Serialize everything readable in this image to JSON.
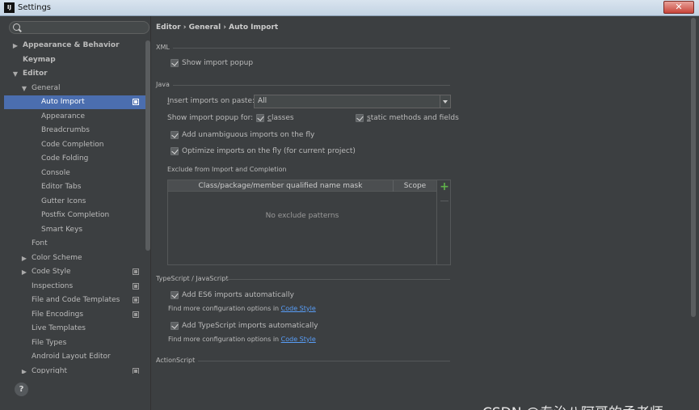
{
  "window": {
    "title": "Settings",
    "app_icon_text": "IJ"
  },
  "search": {
    "placeholder": ""
  },
  "tree": [
    {
      "label": "Appearance & Behavior",
      "level": 0,
      "arrow": "right",
      "bold": true
    },
    {
      "label": "Keymap",
      "level": 0,
      "arrow": "",
      "bold": true
    },
    {
      "label": "Editor",
      "level": 0,
      "arrow": "down",
      "bold": true
    },
    {
      "label": "General",
      "level": 1,
      "arrow": "down"
    },
    {
      "label": "Auto Import",
      "level": 2,
      "arrow": "",
      "selected": true,
      "project_icon": true
    },
    {
      "label": "Appearance",
      "level": 2,
      "arrow": ""
    },
    {
      "label": "Breadcrumbs",
      "level": 2,
      "arrow": ""
    },
    {
      "label": "Code Completion",
      "level": 2,
      "arrow": ""
    },
    {
      "label": "Code Folding",
      "level": 2,
      "arrow": ""
    },
    {
      "label": "Console",
      "level": 2,
      "arrow": ""
    },
    {
      "label": "Editor Tabs",
      "level": 2,
      "arrow": ""
    },
    {
      "label": "Gutter Icons",
      "level": 2,
      "arrow": ""
    },
    {
      "label": "Postfix Completion",
      "level": 2,
      "arrow": ""
    },
    {
      "label": "Smart Keys",
      "level": 2,
      "arrow": ""
    },
    {
      "label": "Font",
      "level": 1,
      "arrow": ""
    },
    {
      "label": "Color Scheme",
      "level": 1,
      "arrow": "right"
    },
    {
      "label": "Code Style",
      "level": 1,
      "arrow": "right",
      "project_icon": true
    },
    {
      "label": "Inspections",
      "level": 1,
      "arrow": "",
      "project_icon": true
    },
    {
      "label": "File and Code Templates",
      "level": 1,
      "arrow": "",
      "project_icon": true
    },
    {
      "label": "File Encodings",
      "level": 1,
      "arrow": "",
      "project_icon": true
    },
    {
      "label": "Live Templates",
      "level": 1,
      "arrow": ""
    },
    {
      "label": "File Types",
      "level": 1,
      "arrow": ""
    },
    {
      "label": "Android Layout Editor",
      "level": 1,
      "arrow": ""
    },
    {
      "label": "Copyright",
      "level": 1,
      "arrow": "right",
      "project_icon": true
    }
  ],
  "help_label": "?",
  "breadcrumb": "Editor › General › Auto Import",
  "xml": {
    "title": "XML",
    "show_import_popup": {
      "label": "Show import popup",
      "checked": true
    }
  },
  "java": {
    "title": "Java",
    "insert_imports_label": "Insert imports on paste:",
    "insert_imports_value": "All",
    "show_popup_for_label": "Show import popup for:",
    "classes": {
      "label": "classes",
      "checked": true
    },
    "static_methods": {
      "label": "static methods and fields",
      "checked": true
    },
    "add_unambiguous": {
      "label": "Add unambiguous imports on the fly",
      "checked": true
    },
    "optimize_imports": {
      "label": "Optimize imports on the fly (for current project)",
      "checked": true
    },
    "exclude_title": "Exclude from Import and Completion",
    "exclude_table": {
      "col_mask": "Class/package/member qualified name mask",
      "col_scope": "Scope",
      "empty_text": "No exclude patterns",
      "add_label": "+"
    }
  },
  "typescript": {
    "title": "TypeScript / JavaScript",
    "es6": {
      "label": "Add ES6 imports automatically",
      "checked": true
    },
    "es6_more_text": "Find more configuration options in ",
    "es6_link": "Code Style",
    "ts": {
      "label": "Add TypeScript imports automatically",
      "checked": true
    },
    "ts_more_text": "Find more configuration options in ",
    "ts_link": "Code Style"
  },
  "actionscript": {
    "title": "ActionScript"
  },
  "watermark": "CSDN @专治八阿哥的孟老师"
}
